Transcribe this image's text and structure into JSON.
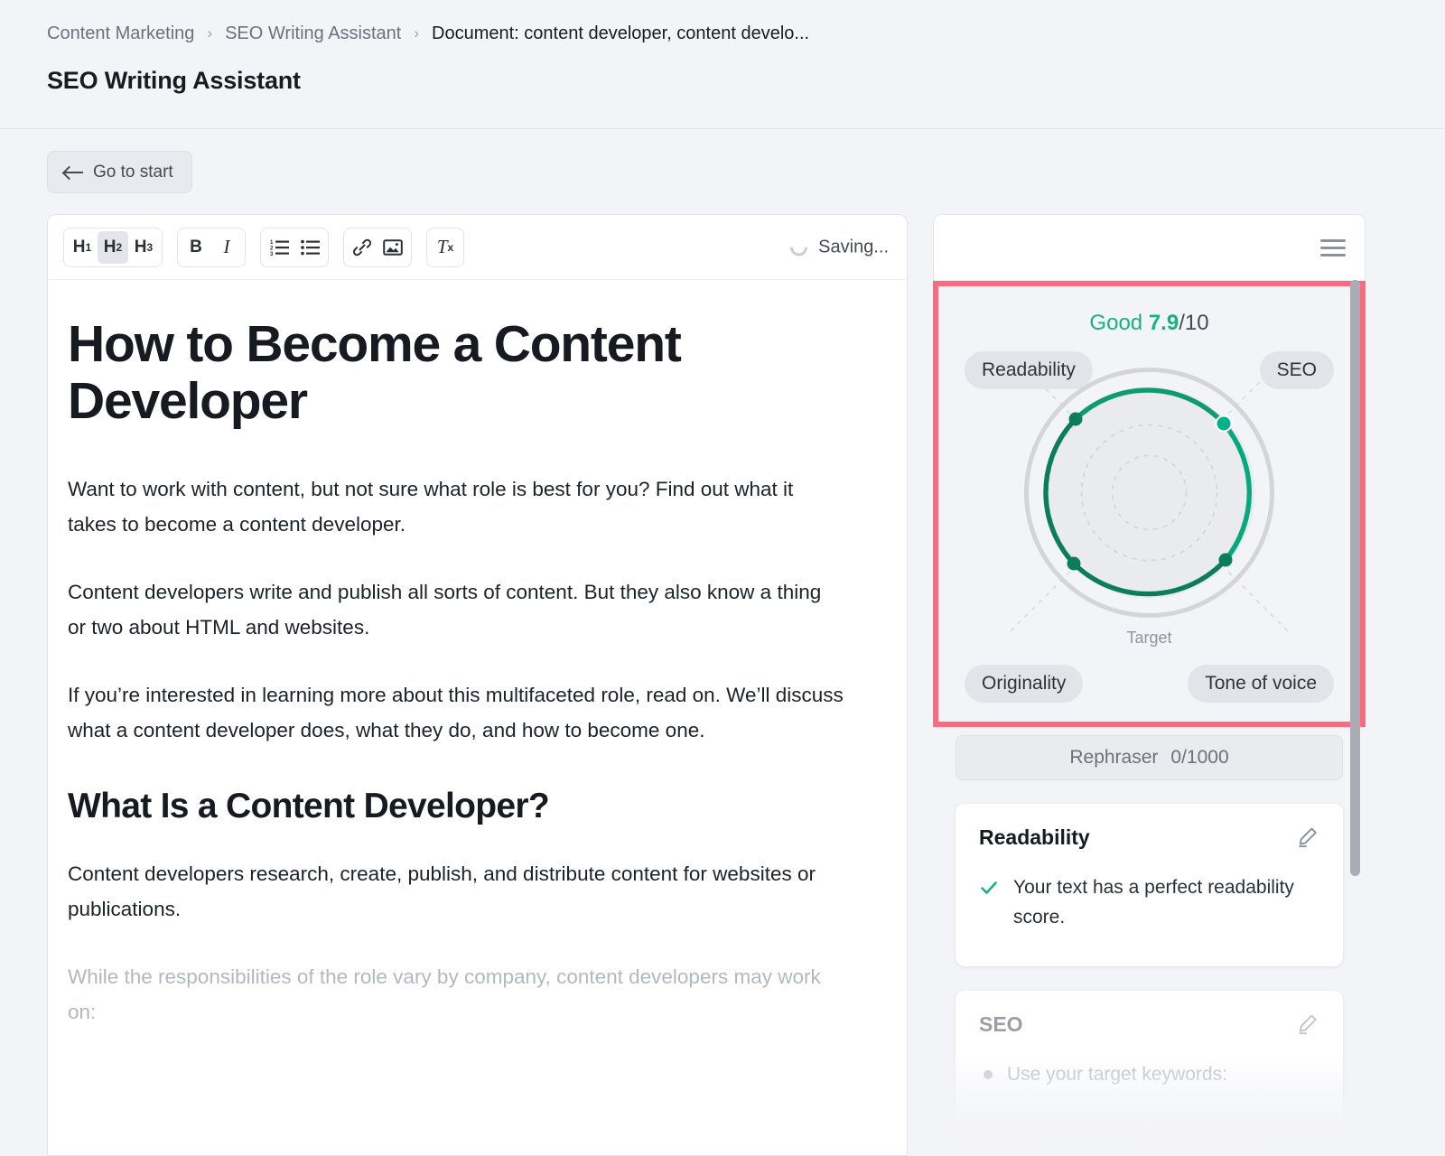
{
  "header": {
    "breadcrumb": [
      {
        "label": "Content Marketing"
      },
      {
        "label": "SEO Writing Assistant"
      },
      {
        "label": "Document: content developer, content develo..."
      }
    ],
    "separator": "›",
    "title": "SEO Writing Assistant"
  },
  "toolbar_top": {
    "go_to_start": "Go to start"
  },
  "editor": {
    "toolbar": {
      "h1": "H",
      "h1_sub": "1",
      "h2": "H",
      "h2_sub": "2",
      "h3": "H",
      "h3_sub": "3",
      "bold": "B",
      "italic": "I",
      "ordered_list": "ordered-list-icon",
      "bullet_list": "bullet-list-icon",
      "link": "link-icon",
      "image": "image-icon",
      "clear_format": "T",
      "clear_format_sub": "x",
      "active_heading": "H2"
    },
    "status": "Saving...",
    "document": {
      "h1": "How to Become a Content Developer",
      "p1": "Want to work with content, but not sure what role is best for you? Find out what it takes to become a content developer.",
      "p2": "Content developers write and publish all sorts of content. But they also know a thing or two about HTML and websites.",
      "p3": "If you’re interested in learning more about this multifaceted role, read on. We’ll discuss what a content developer does, what they do, and how to become one.",
      "h2": "What Is a Content Developer?",
      "p4": "Content developers research, create, publish, and distribute content for websites or publications.",
      "p5": "While the responsibilities of the role vary by company, content developers may work on:"
    }
  },
  "panel": {
    "menu_icon": "hamburger-icon",
    "score": {
      "label": "Good",
      "value": "7.9",
      "denominator": "/10",
      "color_good": "#16b37e"
    },
    "target_label": "Target",
    "metrics": [
      {
        "key": "readability",
        "label": "Readability"
      },
      {
        "key": "seo",
        "label": "SEO"
      },
      {
        "key": "originality",
        "label": "Originality"
      },
      {
        "key": "tone",
        "label": "Tone of voice"
      }
    ],
    "rephraser": {
      "label": "Rephraser",
      "counter": "0/1000"
    },
    "cards": [
      {
        "title": "Readability",
        "status_icon": "check-icon",
        "text": "Your text has a perfect readability score.",
        "edit_icon": "pencil-icon"
      },
      {
        "title": "SEO",
        "status_icon": "bullet-icon",
        "text": "Use your target keywords:",
        "edit_icon": "pencil-icon"
      }
    ],
    "highlight_color": "#fa6b80"
  },
  "chart_data": {
    "type": "radar",
    "title": "Content quality score",
    "score": 7.9,
    "score_max": 10,
    "score_label": "Good",
    "axes": [
      "Readability",
      "SEO",
      "Tone of voice",
      "Originality"
    ],
    "target_ring_label": "Target",
    "target_value": 10,
    "values": [
      9.2,
      8.6,
      8.6,
      9.0
    ],
    "rmax": 10,
    "grid": "dashed-concentric",
    "grid_rings": 3,
    "series_color": "#0b7d58",
    "active_point_color": "#00b288",
    "active_axis": "SEO",
    "target_color": "#d3d5da",
    "legend": "none"
  }
}
